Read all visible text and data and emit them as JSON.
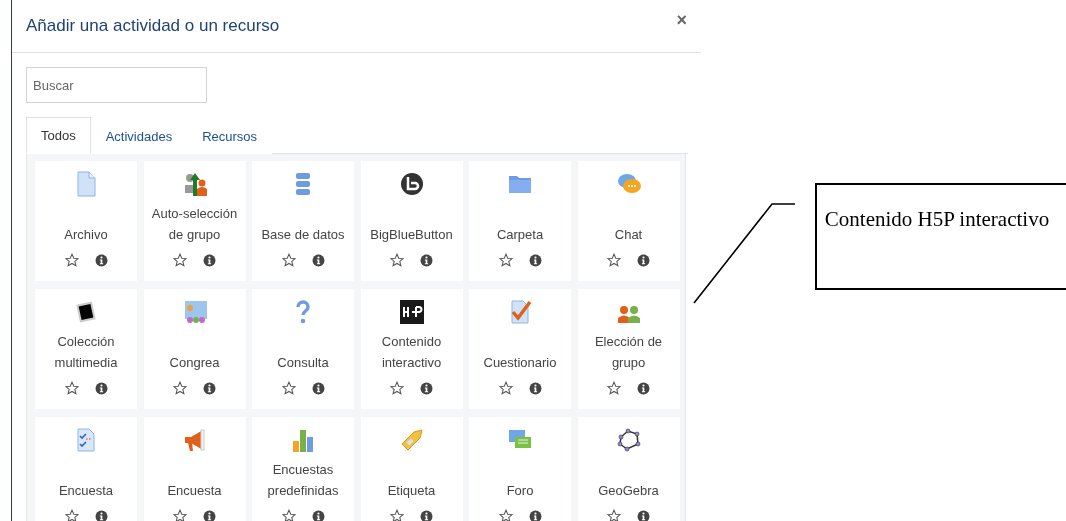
{
  "dialog": {
    "title": "Añadir una actividad o un recurso",
    "close": "×"
  },
  "search": {
    "placeholder": "Buscar"
  },
  "tabs": [
    {
      "label": "Todos",
      "selected": true
    },
    {
      "label": "Actividades",
      "selected": false
    },
    {
      "label": "Recursos",
      "selected": false
    }
  ],
  "modules": [
    {
      "name": "Archivo",
      "starred": false
    },
    {
      "name": "Auto-selección de grupo",
      "starred": false
    },
    {
      "name": "Base de datos",
      "starred": false
    },
    {
      "name": "BigBlueButton",
      "starred": false
    },
    {
      "name": "Carpeta",
      "starred": false
    },
    {
      "name": "Chat",
      "starred": false
    },
    {
      "name": "Colección multimedia",
      "starred": false
    },
    {
      "name": "Congrea",
      "starred": false
    },
    {
      "name": "Consulta",
      "starred": false
    },
    {
      "name": "Contenido interactivo",
      "starred": false
    },
    {
      "name": "Cuestionario",
      "starred": false
    },
    {
      "name": "Elección de grupo",
      "starred": false
    },
    {
      "name": "Encuesta",
      "starred": false
    },
    {
      "name": "Encuesta",
      "starred": false
    },
    {
      "name": "Encuestas predefinidas",
      "starred": false
    },
    {
      "name": "Etiqueta",
      "starred": false
    },
    {
      "name": "Foro",
      "starred": false
    },
    {
      "name": "GeoGebra",
      "starred": false
    }
  ],
  "callout": {
    "text": "Contenido H5P interactivo"
  }
}
